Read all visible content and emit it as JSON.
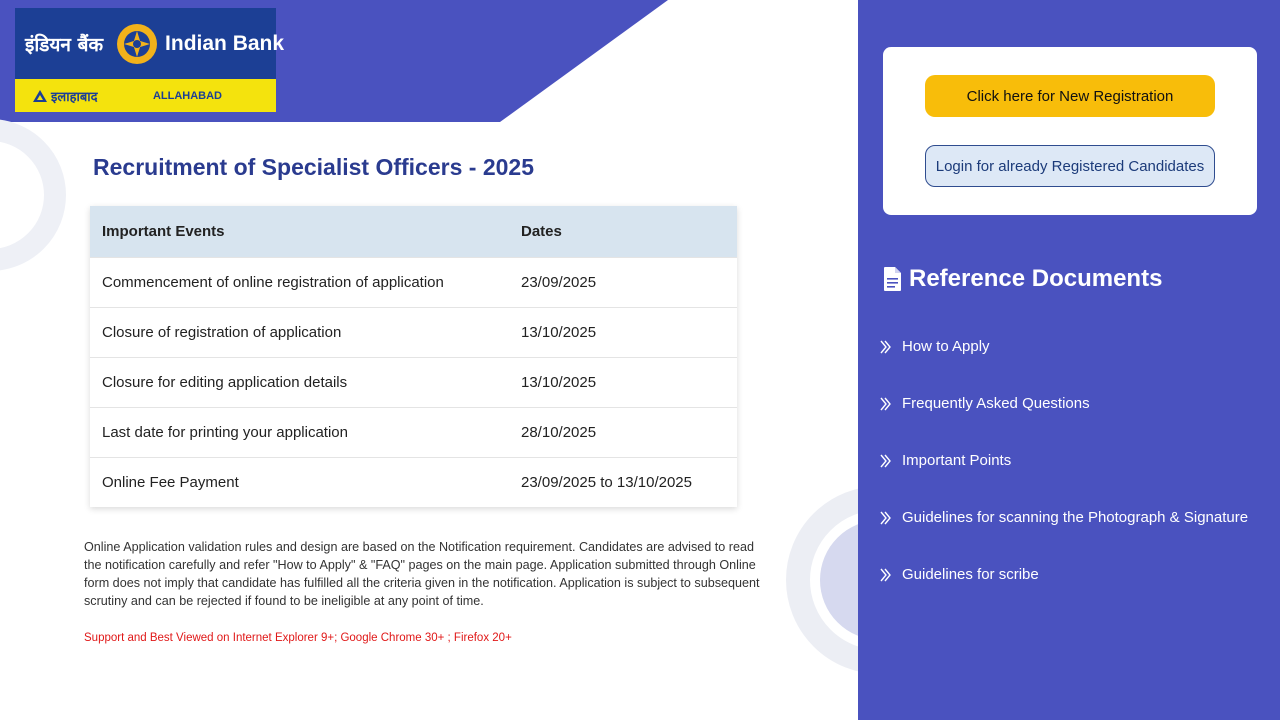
{
  "logo": {
    "hindi_name": "इंडियन बैंक",
    "english_name": "Indian Bank",
    "allahabad_hindi": "इलाहाबाद",
    "allahabad_english": "ALLAHABAD"
  },
  "main": {
    "title": "Recruitment of Specialist Officers - 2025",
    "table": {
      "headers": [
        "Important Events",
        "Dates"
      ],
      "rows": [
        [
          "Commencement of online registration of application",
          "23/09/2025"
        ],
        [
          "Closure of registration of application",
          "13/10/2025"
        ],
        [
          "Closure for editing application details",
          "13/10/2025"
        ],
        [
          "Last date for printing your application",
          "28/10/2025"
        ],
        [
          "Online Fee Payment",
          "23/09/2025 to 13/10/2025"
        ]
      ]
    },
    "notice": "Online Application validation rules and design are based on the Notification requirement. Candidates are advised to read the notification carefully and refer \"How to Apply\" & \"FAQ\" pages on the main page. Application submitted through Online form does not imply that candidate has fulfilled all the criteria given in the notification. Application is subject to subsequent scrutiny and can be rejected if found to be ineligible at any point of time.",
    "support": "Support and Best Viewed on Internet Explorer 9+; Google Chrome 30+ ; Firefox 20+"
  },
  "sidebar": {
    "register_label": "Click here for New Registration",
    "login_label": "Login for already Registered Candidates",
    "reference_heading": "Reference Documents",
    "links": [
      "How to Apply",
      "Frequently Asked Questions",
      "Important Points",
      "Guidelines for scanning the Photograph & Signature",
      "Guidelines for scribe"
    ]
  },
  "colors": {
    "panel_bg": "#4a52bf",
    "register_button": "#f8bd0a",
    "title_text": "#2a3b8f",
    "support_text": "#e01818",
    "logo_blue": "#1c3f95",
    "logo_yellow": "#f4e30d"
  },
  "icons": {
    "reference_heading": "document-icon",
    "links": "chevron-right-icon",
    "logo": "indian-bank-emblem-icon"
  }
}
